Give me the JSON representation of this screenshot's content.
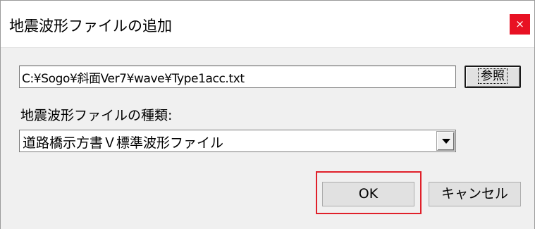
{
  "window": {
    "title": "地震波形ファイルの追加",
    "close_glyph": "×"
  },
  "file": {
    "path_value": "C:¥Sogo¥斜面Ver7¥wave¥Type1acc.txt",
    "browse_label": "参照"
  },
  "wave_type": {
    "label": "地震波形ファイルの種類:",
    "selected": "道路橋示方書Ｖ標準波形ファイル"
  },
  "actions": {
    "ok_label": "OK",
    "cancel_label": "キャンセル"
  },
  "colors": {
    "close_button": "#e81123",
    "highlight_frame": "#e0202a"
  },
  "icons": {
    "close": "close-icon",
    "dropdown": "chevron-down-icon"
  }
}
